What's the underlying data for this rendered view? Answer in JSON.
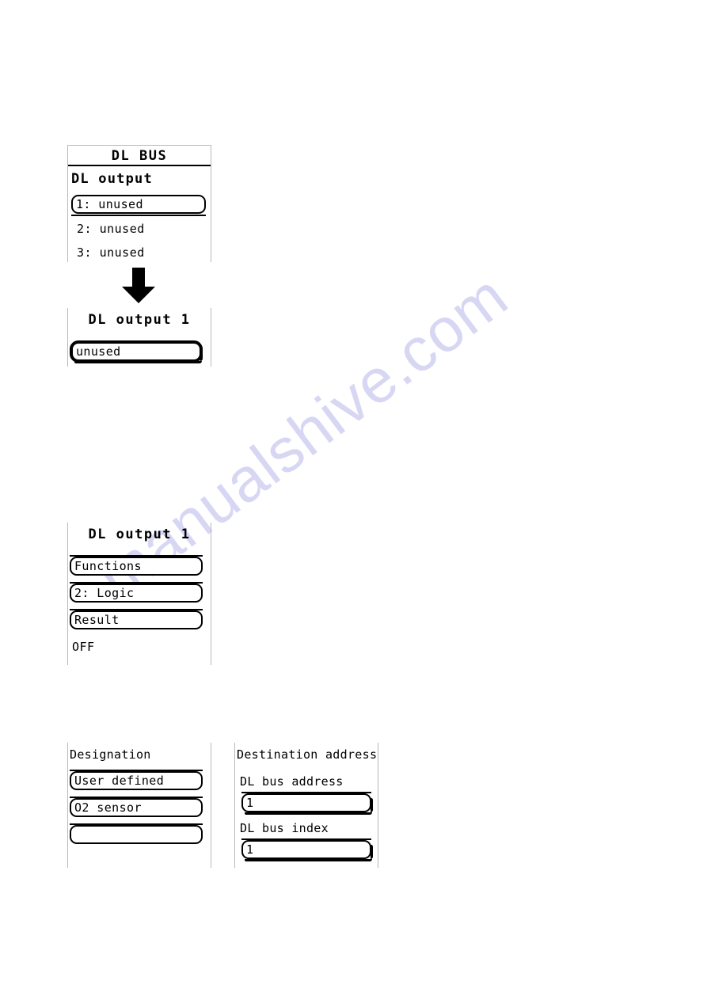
{
  "watermark": {
    "text": "manualshive.com",
    "color": "#d7d7f4"
  },
  "panels": {
    "dl_bus": {
      "title": "DL BUS",
      "section_label": "DL output",
      "rows": [
        {
          "label": "1: unused",
          "selected": true
        },
        {
          "label": "2: unused",
          "selected": false
        },
        {
          "label": "3: unused",
          "selected": false
        }
      ]
    },
    "dl_output_selected": {
      "title": "DL output 1",
      "value_field": "unused"
    },
    "dl_output_detail": {
      "title": "DL output 1",
      "fields": [
        {
          "label": "Functions"
        },
        {
          "label": "2: Logic"
        },
        {
          "label": "Result"
        }
      ],
      "status": "OFF"
    },
    "designation": {
      "title": "Designation",
      "fields": [
        {
          "label": "User defined"
        },
        {
          "label": "O2 sensor"
        },
        {
          "label": ""
        }
      ]
    },
    "destination_address": {
      "title": "Destination address",
      "groups": [
        {
          "label": "DL bus address",
          "value": "1"
        },
        {
          "label": "DL bus index",
          "value": "1"
        }
      ]
    }
  },
  "arrow": {
    "icon": "arrow-down-icon"
  }
}
